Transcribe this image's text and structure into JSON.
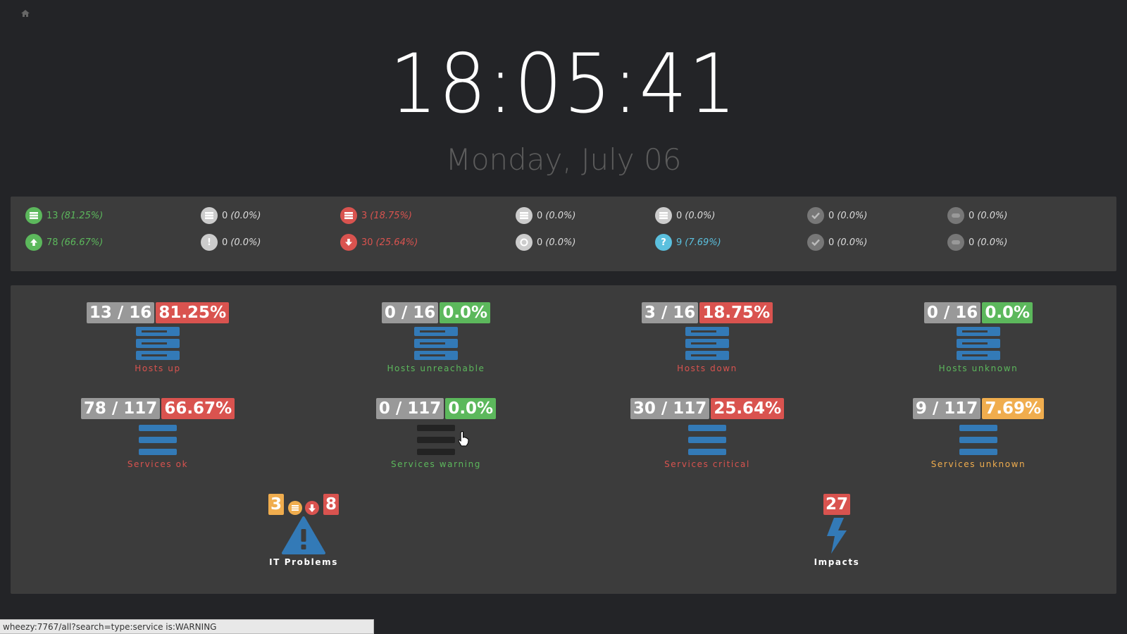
{
  "clock": {
    "time": "18:05:41",
    "date": "Monday, July 06"
  },
  "colors": {
    "ok": "#5cb85c",
    "critical": "#d9534f",
    "warning": "#f0ad4e",
    "info": "#5bc0de",
    "muted": "#999999",
    "icon_blue": "#337ab7"
  },
  "summary": {
    "row1": [
      {
        "icon": "host-up-icon",
        "count": "13",
        "pct": "(81.25%)",
        "color": "#5cb85c"
      },
      {
        "icon": "host-unreachable-icon",
        "count": "0",
        "pct": "(0.0%)",
        "color": "#dddddd"
      },
      {
        "icon": "host-down-icon",
        "count": "3",
        "pct": "(18.75%)",
        "color": "#d9534f"
      },
      {
        "icon": "host-pending-icon",
        "count": "0",
        "pct": "(0.0%)",
        "color": "#dddddd"
      },
      {
        "icon": "host-unknown-icon",
        "count": "0",
        "pct": "(0.0%)",
        "color": "#dddddd"
      },
      {
        "icon": "host-ack-icon",
        "count": "0",
        "pct": "(0.0%)",
        "color": "#dddddd"
      },
      {
        "icon": "host-downtime-icon",
        "count": "0",
        "pct": "(0.0%)",
        "color": "#dddddd"
      }
    ],
    "row2": [
      {
        "icon": "service-ok-icon",
        "count": "78",
        "pct": "(66.67%)",
        "color": "#5cb85c"
      },
      {
        "icon": "service-warning-icon",
        "count": "0",
        "pct": "(0.0%)",
        "color": "#dddddd"
      },
      {
        "icon": "service-critical-icon",
        "count": "30",
        "pct": "(25.64%)",
        "color": "#d9534f"
      },
      {
        "icon": "service-pending-icon",
        "count": "0",
        "pct": "(0.0%)",
        "color": "#dddddd"
      },
      {
        "icon": "service-unknown-icon",
        "count": "9",
        "pct": "(7.69%)",
        "color": "#5bc0de"
      },
      {
        "icon": "service-ack-icon",
        "count": "0",
        "pct": "(0.0%)",
        "color": "#dddddd"
      },
      {
        "icon": "service-downtime-icon",
        "count": "0",
        "pct": "(0.0%)",
        "color": "#dddddd"
      }
    ]
  },
  "tiles": {
    "hosts_up": {
      "count": "13 / 16",
      "pct": "81.25%",
      "label": "Hosts up"
    },
    "hosts_unreachable": {
      "count": "0 / 16",
      "pct": "0.0%",
      "label": "Hosts unreachable"
    },
    "hosts_down": {
      "count": "3 / 16",
      "pct": "18.75%",
      "label": "Hosts down"
    },
    "hosts_unknown": {
      "count": "0 / 16",
      "pct": "0.0%",
      "label": "Hosts unknown"
    },
    "services_ok": {
      "count": "78 / 117",
      "pct": "66.67%",
      "label": "Services ok"
    },
    "services_warning": {
      "count": "0 / 117",
      "pct": "0.0%",
      "label": "Services warning"
    },
    "services_critical": {
      "count": "30 / 117",
      "pct": "25.64%",
      "label": "Services critical"
    },
    "services_unknown": {
      "count": "9 / 117",
      "pct": "7.69%",
      "label": "Services unknown"
    }
  },
  "problems": {
    "host_count": "3",
    "service_count": "8",
    "label": "IT Problems"
  },
  "impacts": {
    "count": "27",
    "label": "Impacts"
  },
  "status_bar": {
    "url": "wheezy:7767/all?search=type:service is:WARNING"
  }
}
